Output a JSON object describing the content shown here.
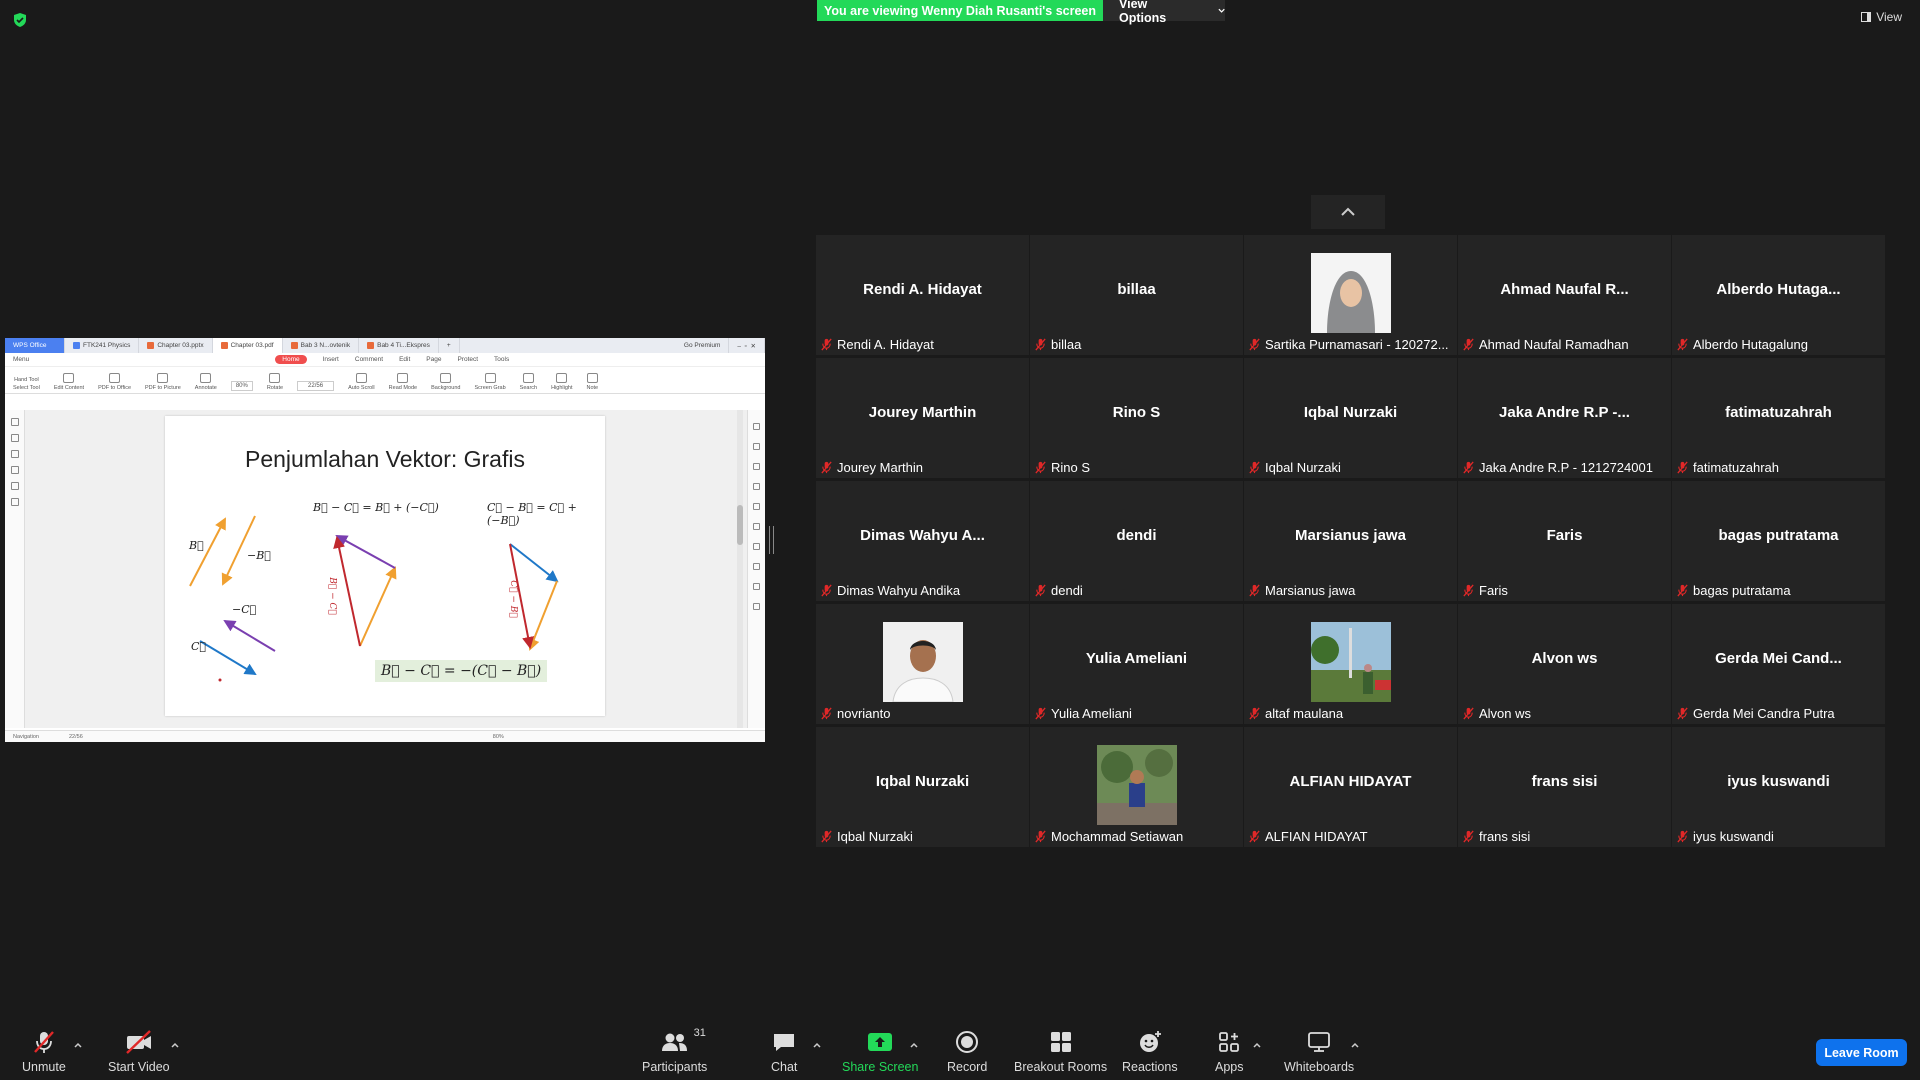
{
  "banner": {
    "viewing": "You are viewing Wenny Diah Rusanti's screen",
    "view_options": "View Options",
    "view": "View"
  },
  "shared_screen": {
    "tabs": [
      "WPS Office",
      "FTK241 Physics",
      "Chapter 03.pptx",
      "Chapter 03.pdf",
      "Bab 3 N...ovtenik",
      "Bab 4 Ti...Ekspres"
    ],
    "go_premium": "Go Premium",
    "menu": [
      "Menu",
      "Home",
      "Insert",
      "Comment",
      "Edit",
      "Page",
      "Protect",
      "Tools"
    ],
    "tools": [
      "Hand Tool",
      "Select Tool",
      "Edit Content",
      "PDF to Office",
      "PDF to Picture",
      "Annotate",
      "Rotate",
      "Auto Scroll",
      "Read Mode",
      "Background",
      "Screen Grab",
      "Search",
      "Highlight",
      "Note"
    ],
    "zoom": "80%",
    "page": "22/56",
    "status_nav": "Navigation",
    "status_page": "22/56",
    "status_zoom": "80%",
    "slide": {
      "title": "Penjumlahan Vektor: Grafis",
      "eq1": "B⃗ − C⃗ = B⃗ + (−C⃗)",
      "eq2": "C⃗ − B⃗ = C⃗ + (−B⃗)",
      "eq3": "B⃗ − C⃗ = −(C⃗ − B⃗)",
      "label_b": "B⃗",
      "label_negb": "−B⃗",
      "label_negc": "−C⃗",
      "label_c": "C⃗",
      "label_bc": "B⃗ − C⃗",
      "label_cb": "C⃗ − B⃗"
    }
  },
  "participants": [
    {
      "big": "Rendi A. Hidayat",
      "name": "Rendi A. Hidayat",
      "photo": false
    },
    {
      "big": "billaa",
      "name": "billaa",
      "photo": false
    },
    {
      "big": "",
      "name": "Sartika Purnamasari - 120272...",
      "photo": "hijab"
    },
    {
      "big": "Ahmad Naufal R...",
      "name": "Ahmad Naufal Ramadhan",
      "photo": false
    },
    {
      "big": "Alberdo  Hutaga...",
      "name": "Alberdo Hutagalung",
      "photo": false
    },
    {
      "big": "Jourey Marthin",
      "name": "Jourey Marthin",
      "photo": false
    },
    {
      "big": "Rino S",
      "name": "Rino S",
      "photo": false
    },
    {
      "big": "Iqbal Nurzaki",
      "name": "Iqbal Nurzaki",
      "photo": false
    },
    {
      "big": "Jaka Andre R.P -...",
      "name": "Jaka Andre R.P - 1212724001",
      "photo": false
    },
    {
      "big": "fatimatuzahrah",
      "name": "fatimatuzahrah",
      "photo": false
    },
    {
      "big": "Dimas Wahyu A...",
      "name": "Dimas Wahyu Andika",
      "photo": false
    },
    {
      "big": "dendi",
      "name": "dendi",
      "photo": false
    },
    {
      "big": "Marsianus jawa",
      "name": "Marsianus jawa",
      "photo": false
    },
    {
      "big": "Faris",
      "name": "Faris",
      "photo": false
    },
    {
      "big": "bagas putratama",
      "name": "bagas putratama",
      "photo": false
    },
    {
      "big": "",
      "name": "novrianto",
      "photo": "man"
    },
    {
      "big": "Yulia Ameliani",
      "name": "Yulia Ameliani",
      "photo": false
    },
    {
      "big": "",
      "name": "altaf maulana",
      "photo": "outdoor"
    },
    {
      "big": "Alvon ws",
      "name": "Alvon ws",
      "photo": false
    },
    {
      "big": "Gerda  Mei  Cand...",
      "name": "Gerda Mei Candra Putra",
      "photo": false
    },
    {
      "big": "Iqbal Nurzaki",
      "name": "Iqbal Nurzaki",
      "photo": false
    },
    {
      "big": "",
      "name": "Mochammad Setiawan",
      "photo": "kid"
    },
    {
      "big": "ALFIAN HIDAYAT",
      "name": "ALFIAN HIDAYAT",
      "photo": false
    },
    {
      "big": "frans sisi",
      "name": "frans sisi",
      "photo": false
    },
    {
      "big": "iyus kuswandi",
      "name": "iyus kuswandi",
      "photo": false
    }
  ],
  "toolbar": {
    "unmute": "Unmute",
    "start_video": "Start Video",
    "participants": "Participants",
    "participants_count": "31",
    "chat": "Chat",
    "share_screen": "Share Screen",
    "record": "Record",
    "breakout_rooms": "Breakout Rooms",
    "reactions": "Reactions",
    "apps": "Apps",
    "whiteboards": "Whiteboards",
    "leave_room": "Leave Room"
  },
  "colors": {
    "banner_green": "#23d959",
    "leave_blue": "#0e72ed",
    "muted_red": "#e02828",
    "tile_bg": "#242424",
    "bg": "#1a1a1a"
  }
}
